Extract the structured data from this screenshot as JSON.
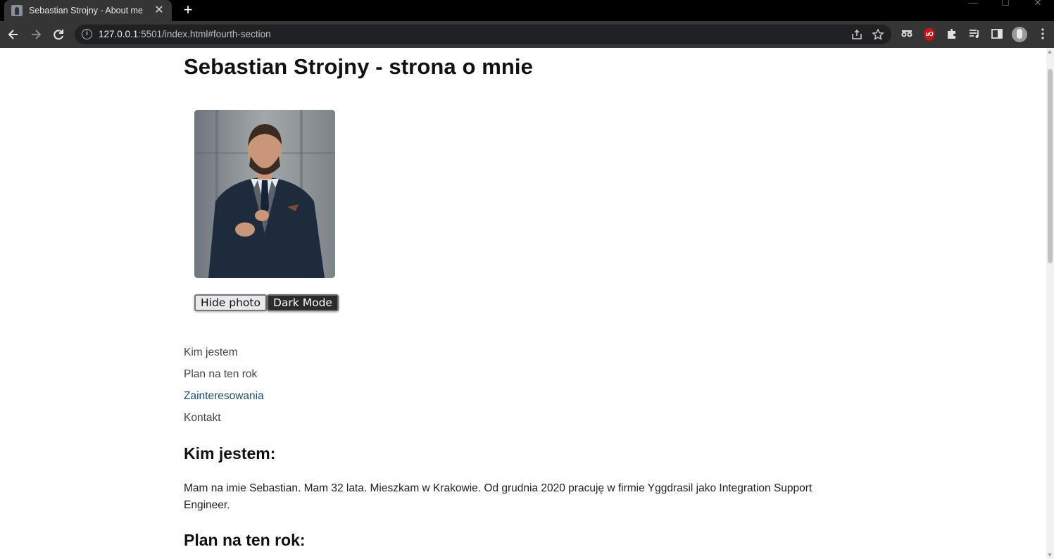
{
  "browser": {
    "tab_title": "Sebastian Strojny - About me",
    "tab_close": "✕",
    "new_tab": "+",
    "url_host": "127.0.0.1",
    "url_rest": ":5501/index.html#fourth-section",
    "window_controls": [
      "—",
      "☐",
      "✕"
    ]
  },
  "page": {
    "title": "Sebastian Strojny - strona o mnie",
    "buttons": {
      "hide_photo": "Hide photo",
      "dark_mode": "Dark Mode"
    },
    "nav": [
      {
        "label": "Kim jestem",
        "active": false
      },
      {
        "label": "Plan na ten rok",
        "active": false
      },
      {
        "label": "Zainteresowania",
        "active": true
      },
      {
        "label": "Kontakt",
        "active": false
      }
    ],
    "sections": [
      {
        "heading": "Kim jestem:",
        "text": "Mam na imie Sebastian. Mam 32 lata. Mieszkam w Krakowie. Od grudnia 2020 pracuję w firmie Yggdrasil jako Integration Support Engineer."
      },
      {
        "heading": "Plan na ten rok:"
      }
    ]
  },
  "colors": {
    "chrome_bg": "#353535",
    "tabbar_bg": "#000000",
    "link_active": "#1c4e6e",
    "dark_button": "#2b2b2b"
  }
}
